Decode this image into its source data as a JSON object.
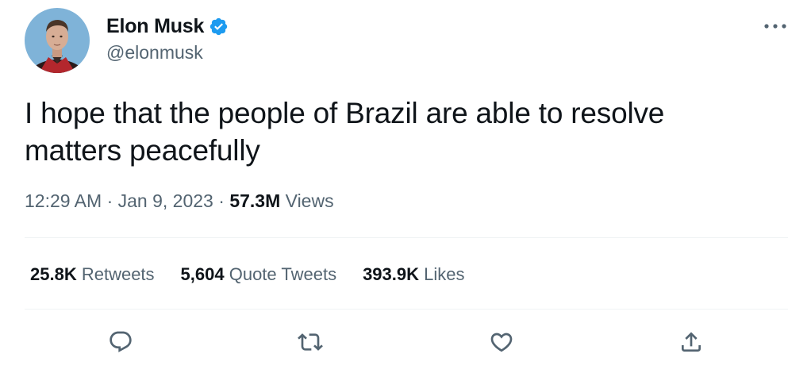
{
  "author": {
    "display_name": "Elon Musk",
    "handle": "@elonmusk",
    "verified": true,
    "verified_icon": "verified-badge-icon",
    "avatar": "profile-photo"
  },
  "tweet": {
    "text_line1": "I hope that the people of Brazil are able to resolve",
    "text_line2": "matters peacefully"
  },
  "meta": {
    "time": "12:29 AM",
    "sep1": " · ",
    "date": "Jan 9, 2023",
    "sep2": " · ",
    "views_count": "57.3M",
    "views_label": " Views"
  },
  "stats": {
    "retweets_count": "25.8K",
    "retweets_label": " Retweets",
    "quotes_count": "5,604",
    "quotes_label": " Quote Tweets",
    "likes_count": "393.9K",
    "likes_label": " Likes"
  },
  "actions": [
    "reply-icon",
    "retweet-icon",
    "like-icon",
    "share-icon"
  ],
  "colors": {
    "text_primary": "#0f1419",
    "text_secondary": "#536471",
    "verified_blue": "#1d9bf0",
    "divider": "#eff3f4"
  }
}
